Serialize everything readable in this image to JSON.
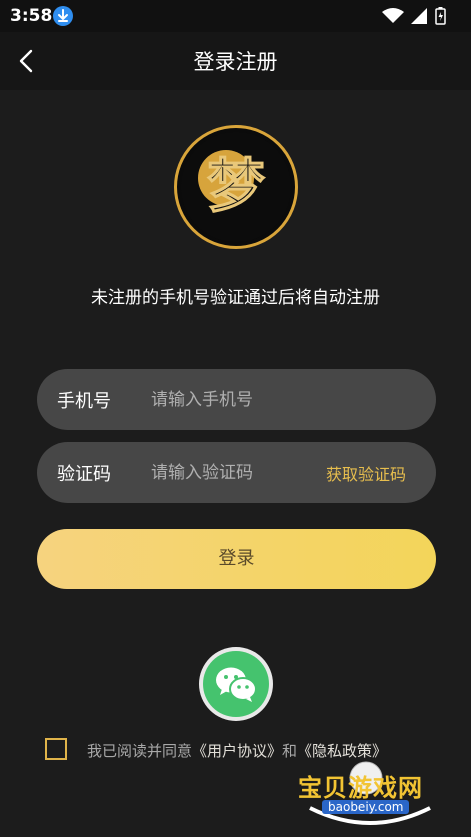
{
  "status_bar": {
    "time": "3:58",
    "download_icon": "download-icon",
    "wifi_icon": "wifi-icon",
    "signal_icon": "signal-icon",
    "battery_icon": "battery-icon"
  },
  "header": {
    "title": "登录注册",
    "back_icon": "chevron-left-icon"
  },
  "logo": {
    "text": "梦",
    "ring_color": "#d9a53a"
  },
  "hint": "未注册的手机号验证通过后将自动注册",
  "phone_field": {
    "label": "手机号",
    "placeholder": "请输入手机号",
    "value": ""
  },
  "code_field": {
    "label": "验证码",
    "placeholder": "请输入验证码",
    "value": "",
    "get_code_label": "获取验证码"
  },
  "login_button": {
    "label": "登录"
  },
  "wechat": {
    "icon": "wechat-icon",
    "color": "#45c36e"
  },
  "agreement": {
    "checked": false,
    "prefix": "我已阅读并同意",
    "user_agreement": "《用户协议》",
    "and": "和",
    "privacy_policy": "《隐私政策》"
  },
  "watermark": {
    "title": "宝贝游戏网",
    "url": "baobeiy.com"
  },
  "colors": {
    "accent": "#e7be4e",
    "button_gradient_start": "#f6d37f",
    "button_gradient_end": "#f3d55a",
    "background": "#1c1c1c",
    "field_bg": "#474747"
  }
}
